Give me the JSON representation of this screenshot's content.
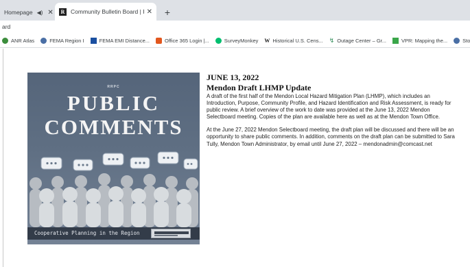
{
  "tabs": [
    {
      "label": "Homepage",
      "active": false
    },
    {
      "label": "Community Bulletin Board | Rutla",
      "active": true
    }
  ],
  "address": {
    "text": "ard"
  },
  "bookmarks": [
    {
      "label": "ANR Atlas",
      "icon": "anr-icon",
      "color": "#3c8d3c"
    },
    {
      "label": "FEMA Region I",
      "icon": "fema-seal-icon",
      "color": "#4a6fa5"
    },
    {
      "label": "FEMA EMI Distance...",
      "icon": "fema-emi-icon",
      "color": "#1a4fa0"
    },
    {
      "label": "Office 365 Login |...",
      "icon": "office-icon",
      "color": "#e2571e"
    },
    {
      "label": "SurveyMonkey",
      "icon": "surveymonkey-icon",
      "color": "#00bf6f"
    },
    {
      "label": "Historical U.S. Cens...",
      "icon": "w-icon",
      "color": "#222222"
    },
    {
      "label": "Outage Center – Gr...",
      "icon": "outage-icon",
      "color": "#2e8b57"
    },
    {
      "label": "VPR: Mapping the...",
      "icon": "vpr-icon",
      "color": "#3aa64a"
    },
    {
      "label": "Sto",
      "icon": "globe-icon",
      "color": "#4a6fa5"
    }
  ],
  "poster": {
    "org": "RRPC",
    "line1": "PUBLIC",
    "line2": "COMMENTS",
    "caption": "Cooperative Planning in the Region"
  },
  "article": {
    "date": "JUNE 13, 2022",
    "title": "Mendon Draft LHMP Update",
    "para1": "A draft of the first half of the Mendon Local Hazard Mitigation Plan (LHMP), which includes an Introduction, Purpose, Community Profile, and Hazard Identification and Risk Assessment, is ready for public review. A brief overview of the work to date was provided at the June 13, 2022 Mendon Selectboard meeting. Copies of the plan are available here as well as at the Mendon Town Office.",
    "para2": "At the June 27, 2022 Mendon Selectboard meeting, the draft plan will be discussed and there will be an opportunity to share public comments. In addition, comments on the draft plan can be submitted to Sara Tully, Mendon Town Administrator, by email until June 27, 2022 – mendonadmin@comcast.net"
  }
}
